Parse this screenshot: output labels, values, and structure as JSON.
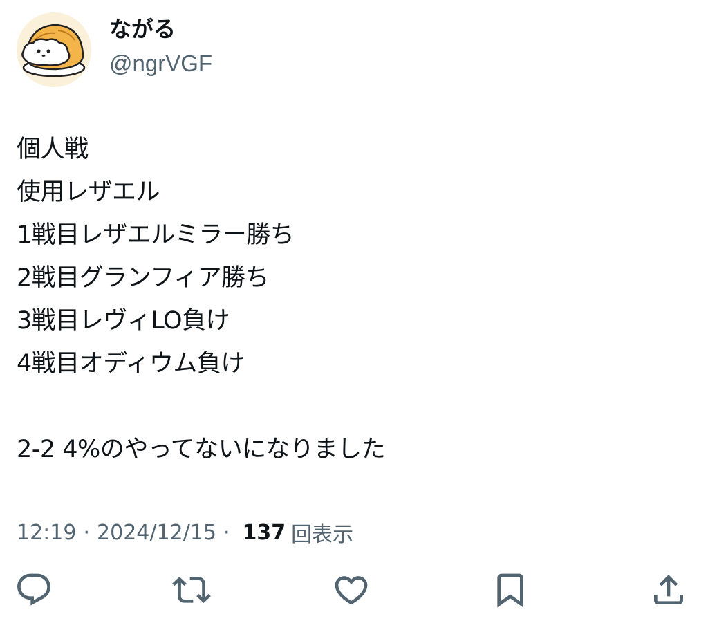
{
  "user": {
    "display_name": "ながる",
    "handle": "@ngrVGF"
  },
  "tweet": {
    "lines": [
      "個人戦",
      "使用レザエル",
      "1戦目レザエルミラー勝ち",
      "2戦目グランフィア勝ち",
      "3戦目レヴィLO負け",
      "4戦目オディウム負け",
      "",
      "2-2 4%のやってないになりました"
    ]
  },
  "meta": {
    "time": "12:19",
    "separator": "·",
    "date": "2024/12/15",
    "views_count": "137",
    "views_label": "回表示"
  },
  "actions": {
    "icons": [
      "reply-icon",
      "retweet-icon",
      "like-icon",
      "bookmark-icon",
      "share-icon"
    ],
    "icon_color": "#536471"
  },
  "colors": {
    "text": "#0f1419",
    "secondary": "#536471",
    "background": "#ffffff"
  }
}
